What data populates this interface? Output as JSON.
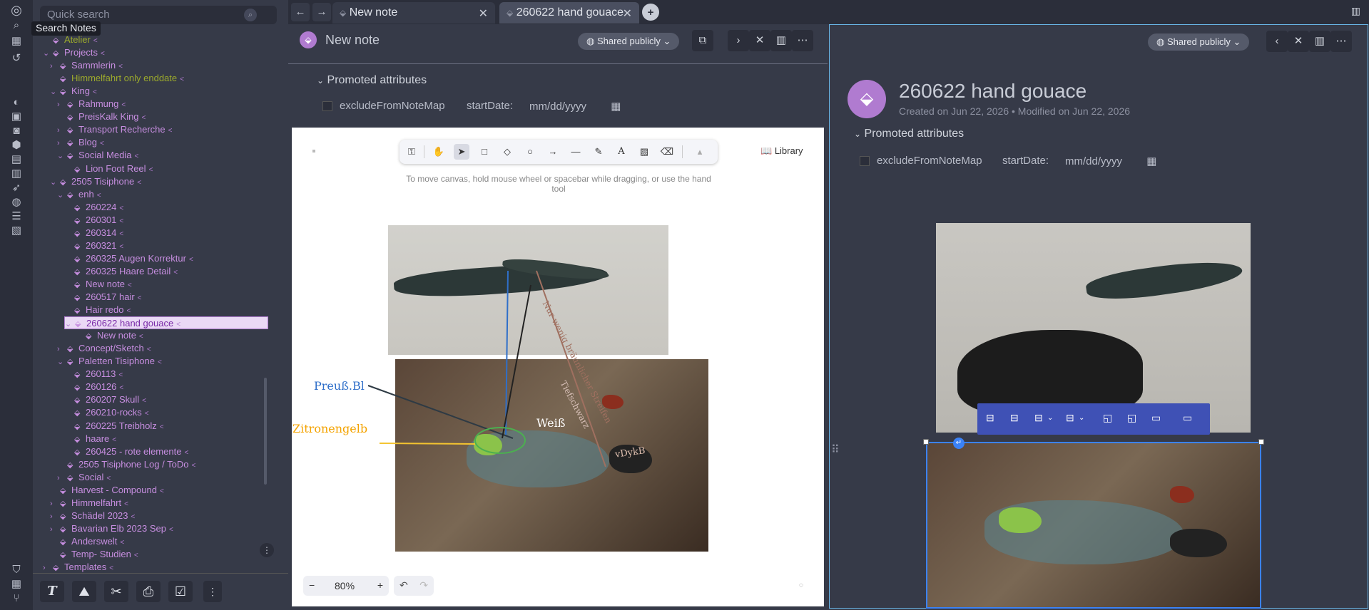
{
  "tooltip": "Search Notes",
  "search": {
    "placeholder": "Quick search"
  },
  "tree": [
    {
      "label": "Atelier",
      "level": 1,
      "chev": "",
      "olive": true
    },
    {
      "label": "Projects",
      "level": 1,
      "chev": "v"
    },
    {
      "label": "Sammlerin",
      "level": 2,
      "chev": ">"
    },
    {
      "label": "Himmelfahrt only enddate",
      "level": 2,
      "chev": "",
      "olive": true
    },
    {
      "label": "King",
      "level": 2,
      "chev": "v"
    },
    {
      "label": "Rahmung",
      "level": 3,
      "chev": ">"
    },
    {
      "label": "PreisKalk King",
      "level": 3,
      "chev": ""
    },
    {
      "label": "Transport Recherche",
      "level": 3,
      "chev": ">"
    },
    {
      "label": "Blog",
      "level": 3,
      "chev": ">"
    },
    {
      "label": "Social Media",
      "level": 3,
      "chev": "v"
    },
    {
      "label": "Lion Foot Reel",
      "level": 4,
      "chev": ""
    },
    {
      "label": "2505 Tisiphone",
      "level": 2,
      "chev": "v"
    },
    {
      "label": "enh",
      "level": 3,
      "chev": "v"
    },
    {
      "label": "260224",
      "level": 4,
      "chev": ""
    },
    {
      "label": "260301",
      "level": 4,
      "chev": ""
    },
    {
      "label": "260314",
      "level": 4,
      "chev": ""
    },
    {
      "label": "260321",
      "level": 4,
      "chev": ""
    },
    {
      "label": "260325 Augen Korrektur",
      "level": 4,
      "chev": ""
    },
    {
      "label": "260325 Haare Detail",
      "level": 4,
      "chev": ""
    },
    {
      "label": "New note",
      "level": 4,
      "chev": ""
    },
    {
      "label": "260517 hair",
      "level": 4,
      "chev": ""
    },
    {
      "label": "Hair redo",
      "level": 4,
      "chev": ""
    },
    {
      "label": "260622 hand gouace",
      "level": 4,
      "chev": "v",
      "selected": true
    },
    {
      "label": "New note",
      "level": 5,
      "chev": ""
    },
    {
      "label": "Concept/Sketch",
      "level": 3,
      "chev": ">"
    },
    {
      "label": "Paletten Tisiphone",
      "level": 3,
      "chev": "v"
    },
    {
      "label": "260113",
      "level": 4,
      "chev": ""
    },
    {
      "label": "260126",
      "level": 4,
      "chev": ""
    },
    {
      "label": "260207 Skull",
      "level": 4,
      "chev": ""
    },
    {
      "label": "260210-rocks",
      "level": 4,
      "chev": ""
    },
    {
      "label": "260225 Treibholz",
      "level": 4,
      "chev": ""
    },
    {
      "label": "haare",
      "level": 4,
      "chev": ""
    },
    {
      "label": "260425 - rote elemente",
      "level": 4,
      "chev": ""
    },
    {
      "label": "2505 Tisiphone Log / ToDo",
      "level": 3,
      "chev": ""
    },
    {
      "label": "Social",
      "level": 3,
      "chev": ">"
    },
    {
      "label": "Harvest - Compound",
      "level": 2,
      "chev": ""
    },
    {
      "label": "Himmelfahrt",
      "level": 2,
      "chev": ">"
    },
    {
      "label": "Schädel 2023",
      "level": 2,
      "chev": ">"
    },
    {
      "label": "Bavarian Elb 2023 Sep",
      "level": 2,
      "chev": ">"
    },
    {
      "label": "Anderswelt",
      "level": 2,
      "chev": ""
    },
    {
      "label": "Temp- Studien",
      "level": 2,
      "chev": ""
    },
    {
      "label": "Templates",
      "level": 1,
      "chev": ">"
    }
  ],
  "tabs": [
    {
      "title": "New note"
    },
    {
      "title": "260622 hand gouace"
    }
  ],
  "pane1": {
    "title": "New note",
    "share": "Shared publicly",
    "promoted": "Promoted attributes",
    "attr1": "excludeFromNoteMap",
    "attr2": "startDate:",
    "date_placeholder": "mm/dd/yyyy",
    "library": "Library",
    "hint": "To move canvas, hold mouse wheel or spacebar while dragging, or use the hand tool",
    "zoom": "80%",
    "annotations": {
      "a1": "Preuß.Bl",
      "a2": "Zitronengelb",
      "a3": "Weiß",
      "a4": "Nur wenig bräunlicher Streifen",
      "a5": "Tiefschwarz",
      "a6": "vDykB"
    }
  },
  "pane2": {
    "title": "260622 hand gouace",
    "share": "Shared publicly",
    "created": "Created on Jun 22, 2026 • Modified on Jun 22, 2026",
    "promoted": "Promoted attributes",
    "attr1": "excludeFromNoteMap",
    "attr2": "startDate:",
    "date_placeholder": "mm/dd/yyyy"
  }
}
